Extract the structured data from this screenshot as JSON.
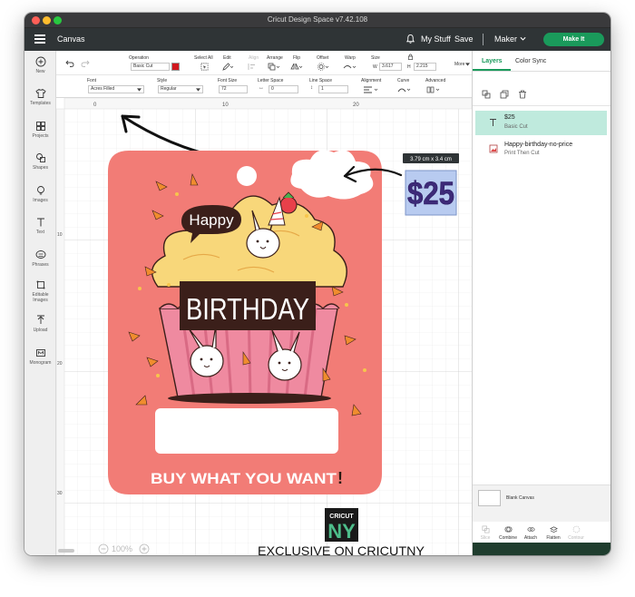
{
  "window": {
    "title": "Cricut Design Space  v7.42.108"
  },
  "header": {
    "section": "Canvas",
    "my_stuff": "My Stuff",
    "save": "Save",
    "machine": "Maker",
    "make_it": "Make It"
  },
  "left_sidebar": {
    "items": [
      {
        "label": "New",
        "icon": "plus-icon"
      },
      {
        "label": "Templates",
        "icon": "shirt-icon"
      },
      {
        "label": "Projects",
        "icon": "grid-icon"
      },
      {
        "label": "Shapes",
        "icon": "shapes-icon"
      },
      {
        "label": "Images",
        "icon": "lightbulb-icon"
      },
      {
        "label": "Text",
        "icon": "text-icon"
      },
      {
        "label": "Phrases",
        "icon": "speech-bubble-icon"
      },
      {
        "label": "Editable",
        "label2": "Images",
        "icon": "edit-image-icon"
      },
      {
        "label": "Upload",
        "icon": "upload-icon"
      },
      {
        "label": "Monogram",
        "icon": "monogram-icon"
      }
    ]
  },
  "toolbar": {
    "operation_label": "Operation",
    "operation_value": "Basic Cut",
    "operation_color": "#d0181e",
    "select_all": "Select All",
    "edit": "Edit",
    "align": "Align",
    "arrange": "Arrange",
    "flip": "Flip",
    "offset": "Offset",
    "warp": "Warp",
    "size": "Size",
    "w_label": "W",
    "w_value": "3.617",
    "h_label": "H",
    "h_value": "2.215",
    "more": "More",
    "font_label": "Font",
    "font_value": "Acres Filled",
    "style_label": "Style",
    "style_value": "Regular",
    "font_size_label": "Font Size",
    "font_size_value": "72",
    "letter_space_label": "Letter Space",
    "letter_space_value": "0",
    "line_space_label": "Line Space",
    "line_space_value": "1",
    "alignment_label": "Alignment",
    "curve_label": "Curve",
    "advanced_label": "Advanced"
  },
  "canvas": {
    "ruler_top": [
      "0",
      "10",
      "20"
    ],
    "ruler_left": [
      "10",
      "20",
      "30"
    ],
    "zoom": "100%",
    "size_tooltip": "3.79  cm x 3.4  cm",
    "selected_text": "$25",
    "card": {
      "color": "#f27c76",
      "happy": "Happy",
      "birthday": "BIRTHDAY",
      "buy": "BUY WHAT YOU WANT",
      "bang": "!"
    },
    "logo": {
      "line1": "CRICUT",
      "line2": "NY"
    },
    "exclusive": "EXCLUSIVE ON CRICUTNY"
  },
  "right_panel": {
    "tabs": [
      "Layers",
      "Color Sync"
    ],
    "layers": [
      {
        "title": "$25",
        "subtitle": "Basic Cut",
        "icon": "text-layer-icon",
        "selected": true
      },
      {
        "title": "Happy-birthday-no-price",
        "subtitle": "Print Then Cut",
        "icon": "image-layer-icon",
        "selected": false
      }
    ],
    "blank_canvas": "Blank Canvas",
    "actions": [
      {
        "label": "Slice",
        "icon": "slice-icon",
        "enabled": false
      },
      {
        "label": "Combine",
        "icon": "combine-icon",
        "enabled": true
      },
      {
        "label": "Attach",
        "icon": "attach-icon",
        "enabled": true
      },
      {
        "label": "Flatten",
        "icon": "flatten-icon",
        "enabled": true
      },
      {
        "label": "Contour",
        "icon": "contour-icon",
        "enabled": false
      }
    ]
  },
  "colors": {
    "header_bg": "#2f3436",
    "make_it_green": "#1a9a5b",
    "selected_layer": "#bfeadd",
    "price_fill": "#b8cbf0",
    "price_text": "#3d2a78"
  }
}
